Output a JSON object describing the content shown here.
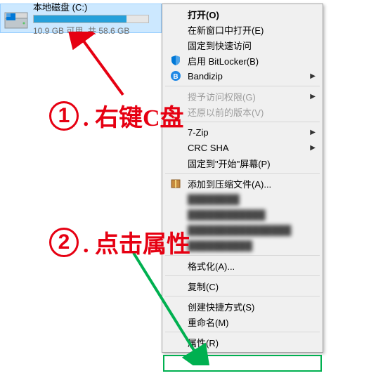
{
  "drive": {
    "label": "本地磁盘 (C:)",
    "free_text": "10.9 GB 可用, 共 58.6 GB",
    "used_percent": 81
  },
  "menu": {
    "open": "打开(O)",
    "open_new_window": "在新窗口中打开(E)",
    "pin_quick": "固定到快速访问",
    "bitlocker": "启用 BitLocker(B)",
    "bandizip": "Bandizip",
    "grant_access": "授予访问权限(G)",
    "prev_versions": "还原以前的版本(V)",
    "seven_zip": "7-Zip",
    "crc_sha": "CRC SHA",
    "pin_start": "固定到\"开始\"屏幕(P)",
    "add_archive": "添加到压缩文件(A)...",
    "format": "格式化(A)...",
    "copy": "复制(C)",
    "create_shortcut": "创建快捷方式(S)",
    "rename": "重命名(M)",
    "properties": "属性(R)"
  },
  "annotations": {
    "step1_num": "1",
    "step1_text": ". 右键C盘",
    "step2_num": "2",
    "step2_text": ". 点击属性"
  },
  "colors": {
    "annotation": "#e60012",
    "highlight": "#00b050",
    "selection": "#cce8ff"
  }
}
